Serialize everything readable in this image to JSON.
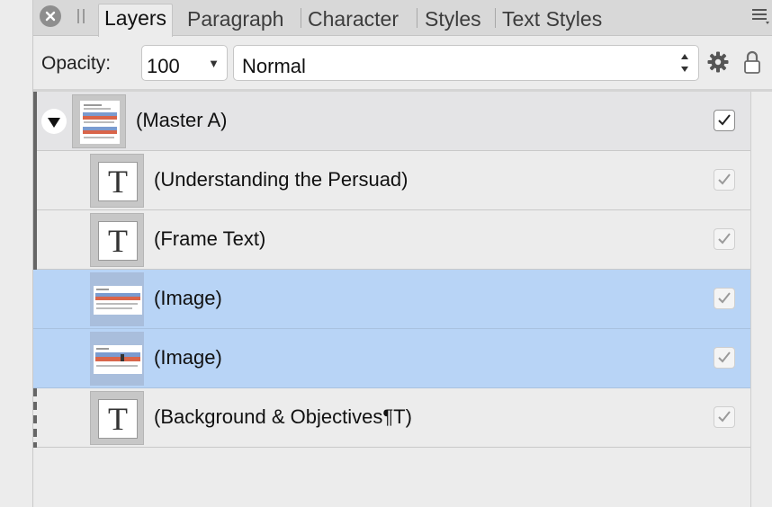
{
  "tabs": {
    "items": [
      "Layers",
      "Paragraph",
      "Character",
      "Styles",
      "Text Styles"
    ],
    "active": "Layers"
  },
  "toolbar": {
    "opacity_label": "Opacity:",
    "opacity_value": "100",
    "blend_mode": "Normal"
  },
  "layers": [
    {
      "name": "(Master A)",
      "kind": "master",
      "visible": true,
      "expanded": true
    },
    {
      "name": "(Understanding the Persuad)",
      "kind": "text",
      "visible": true
    },
    {
      "name": "(Frame Text)",
      "kind": "text",
      "visible": true
    },
    {
      "name": "(Image)",
      "kind": "image",
      "visible": true,
      "selected": true
    },
    {
      "name": "(Image)",
      "kind": "image",
      "visible": true,
      "selected": true
    },
    {
      "name": "(Background & Objectives¶T)",
      "kind": "text",
      "visible": true
    }
  ],
  "icons": {
    "close": "close-icon",
    "grip": "grip-icon",
    "menu": "panel-menu-icon",
    "gear": "gear-icon",
    "lock": "lock-icon",
    "expander": "disclosure-triangle-icon",
    "text_layer": "text-layer-icon"
  },
  "colors": {
    "selected_row": "#b8d4f6",
    "panel_bg": "#ececec",
    "tabbar_bg": "#d8d8d8"
  }
}
